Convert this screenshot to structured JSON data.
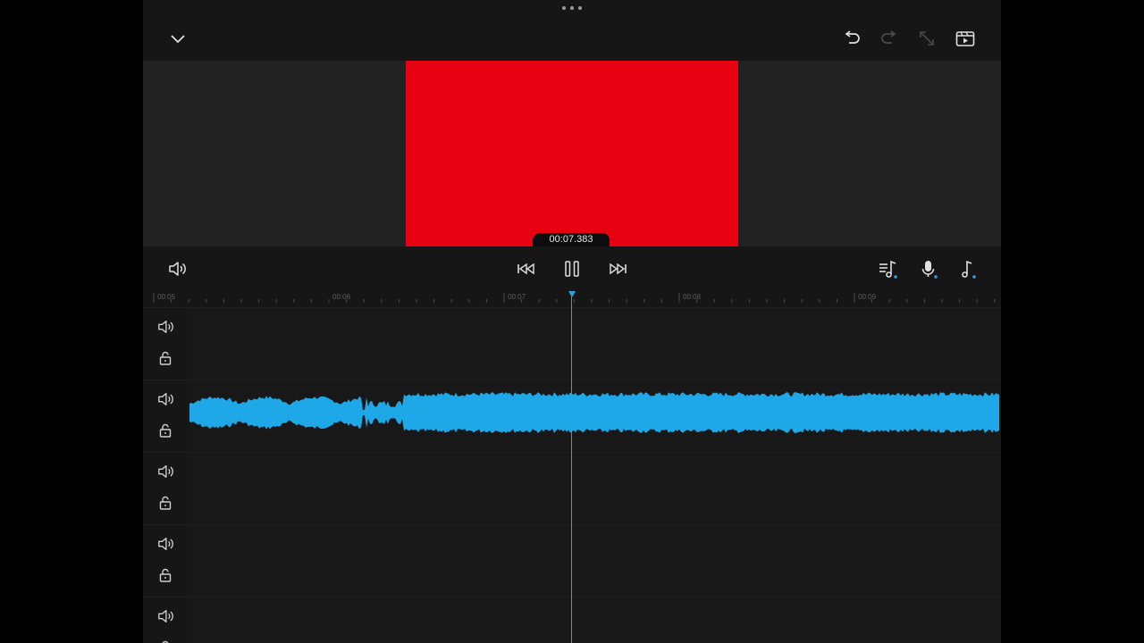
{
  "window": {
    "drag_handle": "more-dots"
  },
  "topbar": {
    "collapse_icon": "chevron-down-icon",
    "undo_icon": "undo-icon",
    "redo_icon": "redo-icon",
    "fullscreen_icon": "expand-icon",
    "export_icon": "export-video-icon"
  },
  "preview": {
    "canvas_color": "#e60012",
    "timecode": "00:07.383"
  },
  "controls": {
    "volume_icon": "speaker-icon",
    "prev_icon": "skip-back-icon",
    "pause_icon": "pause-icon",
    "next_icon": "skip-forward-icon",
    "music_list_icon": "music-list-add-icon",
    "mic_icon": "microphone-add-icon",
    "music_note_icon": "music-note-add-icon"
  },
  "ruler": {
    "labels": [
      "00:05",
      "00:06",
      "00:07",
      "00:08",
      "00:09"
    ]
  },
  "tracks": [
    {
      "mute_icon": "speaker-icon",
      "lock_icon": "lock-icon",
      "has_clip": false
    },
    {
      "mute_icon": "speaker-icon",
      "lock_icon": "lock-icon",
      "has_clip": true,
      "clip_color": "#1fa8e8"
    },
    {
      "mute_icon": "speaker-icon",
      "lock_icon": "lock-icon",
      "has_clip": false
    },
    {
      "mute_icon": "speaker-icon",
      "lock_icon": "lock-icon",
      "has_clip": false
    },
    {
      "mute_icon": "speaker-icon",
      "lock_icon": "lock-icon",
      "has_clip": false
    }
  ],
  "colors": {
    "accent": "#2ba4e6",
    "waveform": "#1fa8e8",
    "background": "#161616"
  }
}
